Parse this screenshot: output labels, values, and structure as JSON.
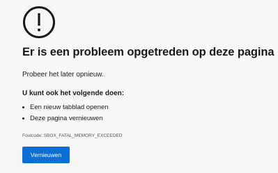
{
  "error": {
    "icon": "exclamation-circle-icon",
    "title": "Er is een probleem opgetreden op deze pagina",
    "subtitle": "Probeer het later opnieuw.",
    "suggestions_heading": "U kunt ook het volgende doen:",
    "suggestions": [
      "Een nieuw tabblad openen",
      "Deze pagina vernieuwen"
    ],
    "error_code": "Foutcode: SBOX_FATAL_MEMORY_EXCEEDED",
    "reload_label": "Vernieuwen"
  },
  "colors": {
    "background": "#f7f7f7",
    "text": "#1a1a1a",
    "button": "#0b6fd6",
    "button_text": "#ffffff"
  }
}
